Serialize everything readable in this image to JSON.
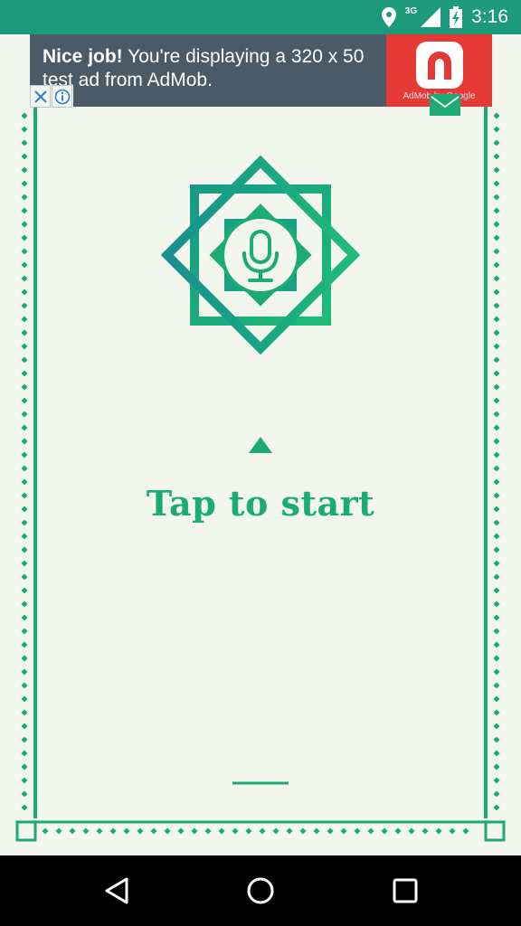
{
  "status_bar": {
    "time": "3:16",
    "network": "3G",
    "icons": [
      "location-icon",
      "signal-icon",
      "battery-icon"
    ]
  },
  "ad_banner": {
    "headline": "Nice job!",
    "text": " You're displaying a 320 x 50 test ad from AdMob.",
    "logo_caption": "AdMob by Google"
  },
  "main": {
    "tap_label": "Tap to start"
  },
  "nav_bar": {
    "buttons": [
      "back-icon",
      "home-icon",
      "recents-icon"
    ]
  },
  "colors": {
    "accent": "#1aab76",
    "accent_dark": "#179a84",
    "status_bar": "#1d9a7a",
    "background": "#f2f6ec",
    "ad_bg": "#4a5a66",
    "ad_logo": "#e53935"
  }
}
